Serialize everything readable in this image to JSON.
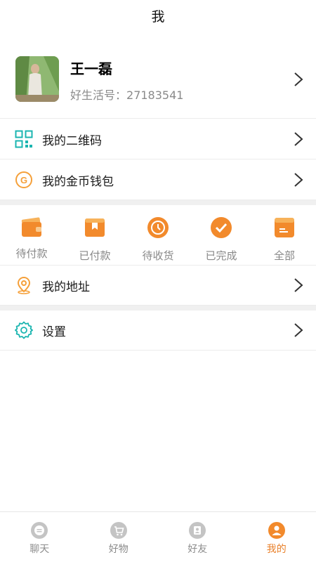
{
  "header": {
    "title": "我"
  },
  "profile": {
    "name": "王一磊",
    "id_label": "好生活号：",
    "id_value": "27183541"
  },
  "menu": {
    "qrcode": "我的二维码",
    "wallet": "我的金币钱包",
    "address": "我的地址",
    "settings": "设置"
  },
  "orders": [
    {
      "label": "待付款",
      "icon": "wallet-icon"
    },
    {
      "label": "已付款",
      "icon": "card-icon"
    },
    {
      "label": "待收货",
      "icon": "clock-icon"
    },
    {
      "label": "已完成",
      "icon": "check-icon"
    },
    {
      "label": "全部",
      "icon": "box-icon"
    }
  ],
  "tabs": [
    {
      "label": "聊天",
      "icon": "chat-icon",
      "active": false
    },
    {
      "label": "好物",
      "icon": "cart-icon",
      "active": false
    },
    {
      "label": "好友",
      "icon": "contact-icon",
      "active": false
    },
    {
      "label": "我的",
      "icon": "user-icon",
      "active": true
    }
  ],
  "colors": {
    "accent": "#e9802a",
    "teal": "#1bb5b0",
    "orange": "#f5a03a",
    "inactive": "#c0c0c0"
  }
}
